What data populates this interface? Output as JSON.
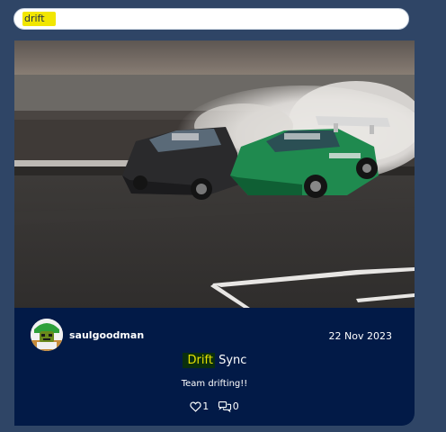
{
  "search": {
    "value": "drift",
    "placeholder": ""
  },
  "post": {
    "image_alt": "Two drift cars sliding on a track with tire smoke",
    "author": "saulgoodman",
    "date": "22 Nov 2023",
    "title_highlight": "Drift",
    "title_rest": " Sync",
    "description": "Team drifting!!",
    "likes": "1",
    "comments": "0"
  },
  "icons": {
    "like": "heart-icon",
    "comment": "comments-icon",
    "avatar": "avatar-character-icon"
  },
  "colors": {
    "page_bg": "#2f4566",
    "card_bg": "#021a47",
    "search_highlight": "#f1e600",
    "title_highlight_bg": "#0a2f0e",
    "title_highlight_text": "#e6e200"
  }
}
